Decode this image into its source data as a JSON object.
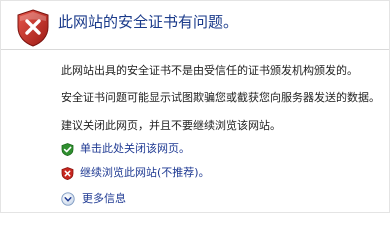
{
  "header": {
    "title": "此网站的安全证书有问题。",
    "icon": "shield-error-icon"
  },
  "body": {
    "paragraph1": "此网站出具的安全证书不是由受信任的证书颁发机构颁发的。",
    "paragraph2": "安全证书问题可能显示试图欺骗您或截获您向服务器发送的数据。",
    "paragraph3": "建议关闭此网页，并且不要继续浏览该网站。"
  },
  "options": {
    "close_label": "单击此处关闭该网页。",
    "close_icon": "green-check-shield-icon",
    "continue_label": "继续浏览此网站(不推荐)。",
    "continue_icon": "red-x-shield-icon"
  },
  "more": {
    "label": "更多信息",
    "icon": "expand-chevron-icon"
  },
  "colors": {
    "title": "#1a3a8a",
    "link": "#1f3a93",
    "error_red": "#c8261f",
    "ok_green": "#2f8f2f"
  }
}
